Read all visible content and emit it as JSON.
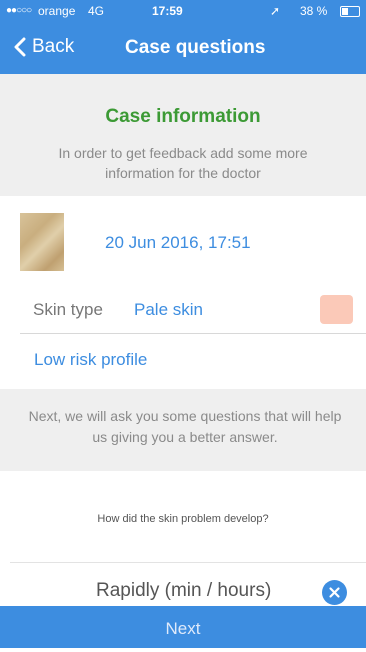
{
  "status": {
    "signal_dots": "●●○○○",
    "carrier": "orange",
    "network": "4G",
    "time": "17:59",
    "battery": "38 %"
  },
  "nav": {
    "back_label": "Back",
    "title": "Case questions"
  },
  "info": {
    "heading": "Case information",
    "text": "In order to get feedback add some more information for the doctor"
  },
  "case": {
    "date": "20 Jun 2016, 17:51"
  },
  "skin": {
    "label": "Skin type",
    "value": "Pale skin",
    "swatch_color": "#fbc9b8"
  },
  "risk": {
    "label": "Low risk profile"
  },
  "next_info": {
    "text": "Next, we will ask you some questions that will help us giving you a better answer."
  },
  "question": {
    "text": "How did the skin problem develop?"
  },
  "answer": {
    "value": "Rapidly (min / hours)"
  },
  "footer": {
    "next_label": "Next"
  },
  "colors": {
    "accent": "#3d8de0",
    "heading_green": "#3c9a35"
  }
}
